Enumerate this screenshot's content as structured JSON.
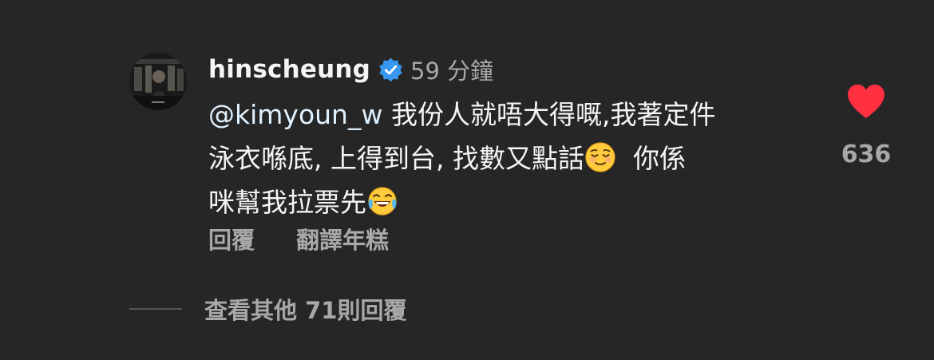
{
  "comment": {
    "username": "hinscheung",
    "timestamp": "59 分鐘",
    "mention": "@kimyoun_w",
    "lines": [
      "我份人就唔大得嘅,我著定件",
      "泳衣喺底, 上得到台, 找數又點話",
      "你係",
      "咪幫我拉票先"
    ],
    "emoji_1": "relieved-face",
    "emoji_2": "face-with-tears-of-joy",
    "like_count": "636",
    "liked": true,
    "accent_color": "#ff3040"
  },
  "actions": {
    "reply_label": "回覆",
    "translate_label": "翻譯年糕"
  },
  "replies": {
    "view_more_label": "查看其他 71則回覆"
  }
}
